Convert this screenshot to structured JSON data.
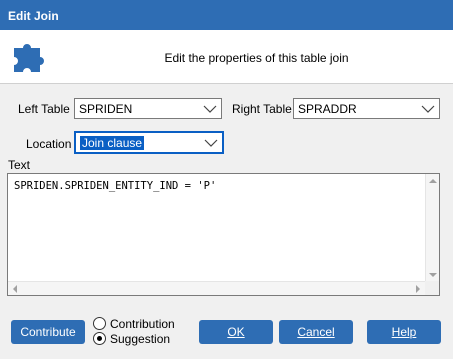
{
  "window": {
    "title": "Edit Join"
  },
  "header": {
    "description": "Edit the properties of this table join",
    "icon": "puzzle-piece-icon"
  },
  "left_table": {
    "label": "Left Table",
    "value": "SPRIDEN"
  },
  "right_table": {
    "label": "Right Table",
    "value": "SPRADDR"
  },
  "location": {
    "label": "Location",
    "value": "Join clause"
  },
  "text": {
    "label": "Text",
    "value": "SPRIDEN.SPRIDEN_ENTITY_IND = 'P'"
  },
  "buttons": {
    "contribute": "Contribute",
    "ok": "OK",
    "cancel": "Cancel",
    "help": "Help"
  },
  "mode": {
    "options": [
      "Contribution",
      "Suggestion"
    ],
    "selected": "Suggestion"
  },
  "colors": {
    "accent": "#2e6db4",
    "focus": "#0a5fc4"
  }
}
